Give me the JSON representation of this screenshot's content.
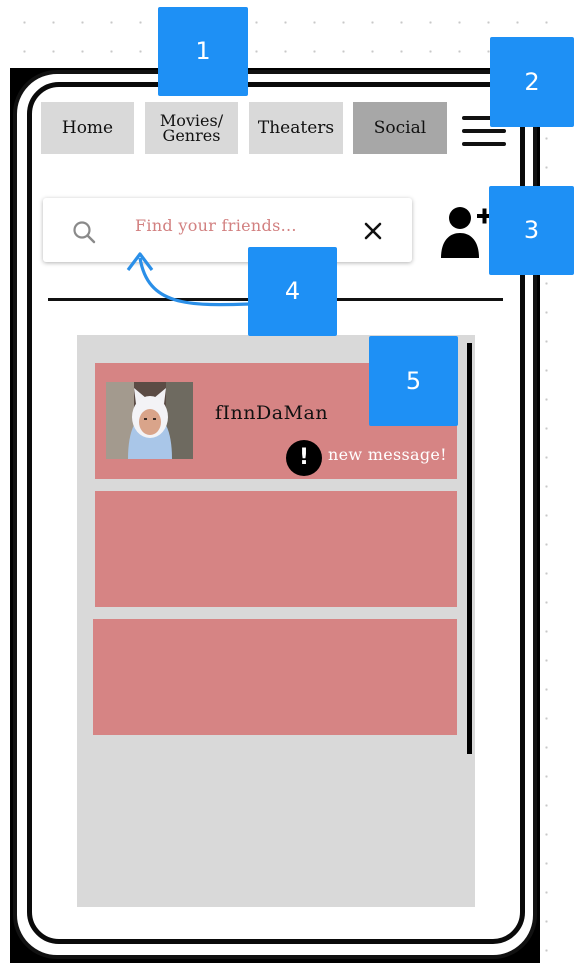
{
  "nav": {
    "home": "Home",
    "movies_line1": "Movies/",
    "movies_line2": "Genres",
    "theaters": "Theaters",
    "social": "Social",
    "active": "Social"
  },
  "menu": {
    "icon": "hamburger-menu-icon"
  },
  "search": {
    "placeholder": "Find your friends...",
    "search_icon": "search-icon",
    "clear_icon": "close-icon"
  },
  "add_friend": {
    "icon": "add-user-icon"
  },
  "friends": {
    "items": [
      {
        "username": "fInnDaMan",
        "status": "new message!",
        "status_icon": "exclamation-icon"
      },
      {
        "username": "",
        "status": ""
      },
      {
        "username": "",
        "status": ""
      }
    ]
  },
  "callouts": [
    "1",
    "2",
    "3",
    "4",
    "5"
  ],
  "colors": {
    "accent": "#1e90f5",
    "card": "#d68484",
    "panel": "#d9d9d9",
    "nav_button": "#d9d9d9",
    "nav_active": "#a7a7a7",
    "placeholder_text": "#d28080"
  }
}
